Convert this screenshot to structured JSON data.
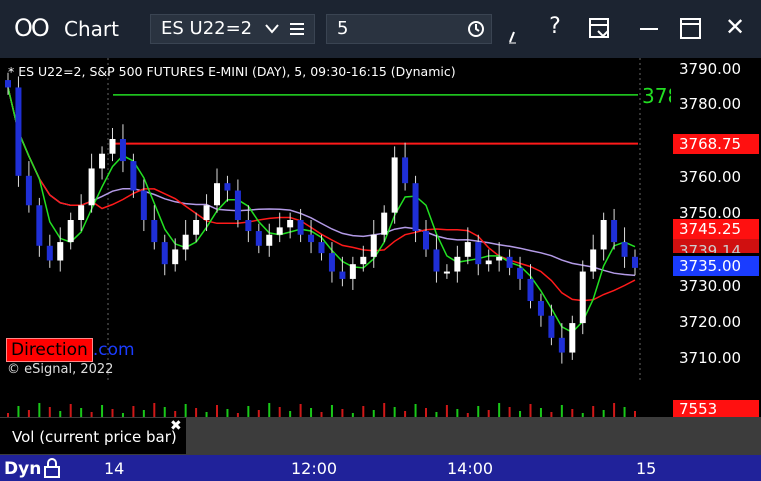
{
  "titlebar": {
    "app_icon": "OO",
    "title": "Chart",
    "symbol": "ES U22=2",
    "interval": "5",
    "icons": [
      "chevron-down-icon",
      "list-icon",
      "clock-icon",
      "draw-icon",
      "help-icon",
      "save-icon",
      "maximize-icon",
      "close-icon"
    ],
    "help_glyph": "?",
    "close_glyph": "✕"
  },
  "chart": {
    "header": "* ES U22=2, S&P 500 FUTURES E-MINI (DAY), 5, 09:30-16:15 (Dynamic)",
    "watermark": "© eSignal, 2022",
    "direction_label": "Direction",
    "direction_suffix": ".com",
    "level_label": "378",
    "price_labels": [
      "3790.00",
      "3780.00",
      "3760.00",
      "3750.00",
      "3730.00",
      "3720.00",
      "3710.00"
    ],
    "tags": {
      "red_line": "3768.75",
      "upper": "3745.25",
      "middle": "3739.14",
      "last": "3735.00",
      "volume": "7553"
    },
    "time_labels": [
      "14",
      "12:00",
      "14:00",
      "15"
    ],
    "timebar_label": "Dyn",
    "volume_label": "Vol (current price bar)",
    "close_x": "✖"
  },
  "chart_data": {
    "type": "candlestick",
    "ylim": [
      3704,
      3792
    ],
    "closes": [
      3784,
      3760,
      3752,
      3741,
      3737,
      3742,
      3748,
      3752,
      3762,
      3766,
      3770,
      3764,
      3756,
      3748,
      3742,
      3736,
      3740,
      3744,
      3748,
      3752,
      3758,
      3756,
      3748,
      3745,
      3741,
      3744,
      3746,
      3748,
      3744,
      3742,
      3739,
      3734,
      3732,
      3736,
      3738,
      3744,
      3750,
      3765,
      3758,
      3745,
      3740,
      3734,
      3734,
      3738,
      3742,
      3736,
      3737,
      3738,
      3735,
      3732,
      3726,
      3722,
      3716,
      3712,
      3720,
      3734,
      3740,
      3748,
      3742,
      3738,
      3735
    ],
    "colors": {
      "up": "#ffffff",
      "down": "#1f2fd6",
      "red_line": "#ff1a1a",
      "green_line": "#22e022",
      "purple_line": "#b39ae6",
      "level": "#22dd22"
    }
  }
}
